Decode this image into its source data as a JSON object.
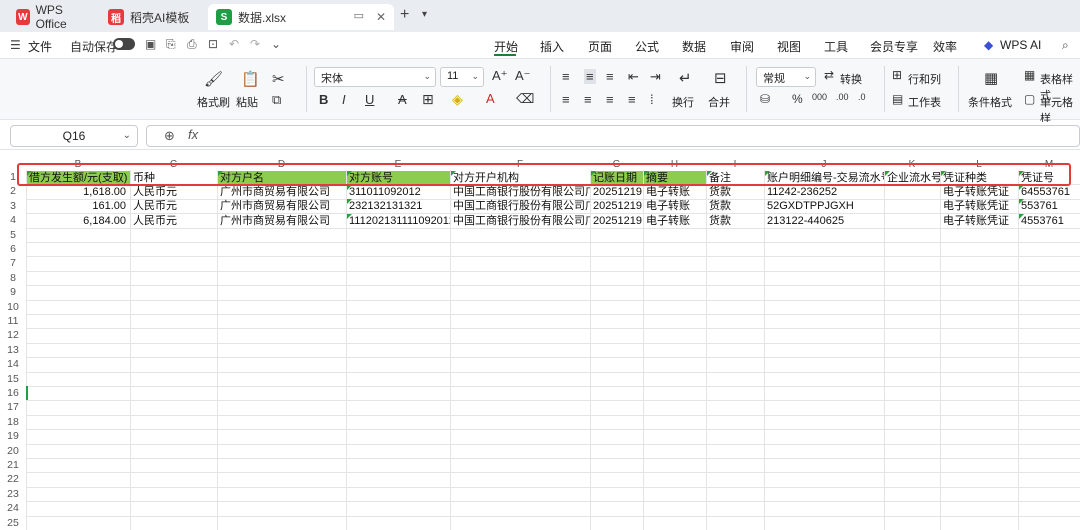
{
  "tabs": [
    {
      "label": "WPS Office",
      "logo": "W",
      "logo_color": "#e8393e"
    },
    {
      "label": "稻壳AI模板",
      "logo": "稻",
      "logo_color": "#e8393e"
    },
    {
      "label": "数据.xlsx",
      "logo": "S",
      "logo_color": "#1f9e45"
    }
  ],
  "menu": {
    "file": "文件",
    "autosave": "自动保存",
    "items": [
      "开始",
      "插入",
      "页面",
      "公式",
      "数据",
      "审阅",
      "视图",
      "工具",
      "会员专享",
      "效率"
    ],
    "active": "开始",
    "wps_ai": "WPS AI"
  },
  "ribbon": {
    "format_painter": "格式刷",
    "paste": "粘贴",
    "font_name": "宋体",
    "font_size": "11",
    "number_format": "常规",
    "convert": "转换",
    "rows_cols": "行和列",
    "worksheet": "工作表",
    "wrap": "换行",
    "merge": "合并",
    "conditional_format": "条件格式",
    "table_style": "表格样式",
    "cell_style": "单元格样"
  },
  "formula_bar": {
    "name_box": "Q16",
    "fx": "fx"
  },
  "columns": [
    "B",
    "C",
    "D",
    "E",
    "F",
    "G",
    "H",
    "I",
    "J",
    "K",
    "L",
    "M"
  ],
  "header_row": [
    "借方发生额/元(支取)",
    "币种",
    "对方户名",
    "对方账号",
    "对方开户机构",
    "记账日期",
    "摘要",
    "备注",
    "账户明细编号-交易流水号",
    "企业流水号",
    "凭证种类",
    "凭证号"
  ],
  "rows": [
    [
      "1,618.00",
      "人民币元",
      "广州市商贸易有限公司",
      "311011092012",
      "中国工商银行股份有限公司广",
      "20251219",
      "电子转账",
      "货款",
      "11242-236252",
      "",
      "电子转账凭证",
      "64553761"
    ],
    [
      "161.00",
      "人民币元",
      "广州市商贸易有限公司",
      "232132131321",
      "中国工商银行股份有限公司广",
      "20251219",
      "电子转账",
      "货款",
      "52GXDTPPJGXH",
      "",
      "电子转账凭证",
      "553761"
    ],
    [
      "6,184.00",
      "人民币元",
      "广州市商贸易有限公司",
      "111202131111092012",
      "中国工商银行股份有限公司广",
      "20251219",
      "电子转账",
      "货款",
      "213122-440625",
      "",
      "电子转账凭证",
      "4553761"
    ]
  ],
  "row_numbers": [
    "1",
    "2",
    "3",
    "4",
    "5",
    "6",
    "7",
    "8",
    "9",
    "10",
    "11",
    "12",
    "13",
    "14",
    "15",
    "16",
    "17",
    "18",
    "19",
    "20",
    "21",
    "22",
    "23",
    "24",
    "25"
  ],
  "colors": {
    "accent": "#1e7e34",
    "header_fill": "#8ccc4f",
    "highlight_box": "#e23b3b"
  }
}
